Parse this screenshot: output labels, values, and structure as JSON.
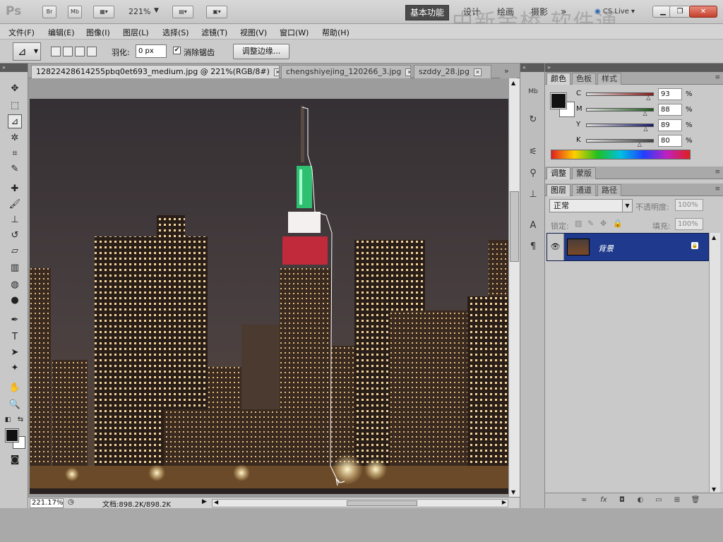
{
  "appbar": {
    "logo": "Ps",
    "bridge": "Br",
    "minibridge": "Mb",
    "zoom": "221%",
    "workspaces": [
      "基本功能",
      "设计",
      "绘画",
      "摄影"
    ],
    "more": "»",
    "cslive": "CS Live",
    "watermark": "中新金桥 软件通"
  },
  "menu": [
    "文件(F)",
    "编辑(E)",
    "图像(I)",
    "图层(L)",
    "选择(S)",
    "滤镜(T)",
    "视图(V)",
    "窗口(W)",
    "帮助(H)"
  ],
  "options": {
    "feather_label": "羽化:",
    "feather_value": "0 px",
    "antialias_label": "消除锯齿",
    "antialias_checked": "✔",
    "refine_edge": "调整边缘..."
  },
  "tabs": [
    {
      "label": "12822428614255pbq0et693_medium.jpg @ 221%(RGB/8#)"
    },
    {
      "label": "chengshiyejing_120266_3.jpg"
    },
    {
      "label": "szddy_28.jpg"
    }
  ],
  "tabs_more": "»",
  "status": {
    "zoom": "221.17%",
    "doc": "文档:898.2K/898.2K"
  },
  "color_panel": {
    "tabs": [
      "颜色",
      "色板",
      "样式"
    ],
    "channels": [
      {
        "label": "C",
        "value": "93",
        "level": 0.93,
        "color": "#8b1a1a"
      },
      {
        "label": "M",
        "value": "88",
        "level": 0.88,
        "color": "#1a5a1a"
      },
      {
        "label": "Y",
        "value": "89",
        "level": 0.89,
        "color": "#1a1a6a"
      },
      {
        "label": "K",
        "value": "80",
        "level": 0.8,
        "color": "#444444"
      }
    ],
    "pct": "%"
  },
  "adjust_panel": {
    "tabs": [
      "调整",
      "蒙版"
    ]
  },
  "layers_panel": {
    "tabs": [
      "图层",
      "通道",
      "路径"
    ],
    "blend_mode": "正常",
    "opacity_label": "不透明度:",
    "opacity_value": "100%",
    "lock_label": "锁定:",
    "fill_label": "填充:",
    "fill_value": "100%",
    "layer_name": "背景"
  }
}
